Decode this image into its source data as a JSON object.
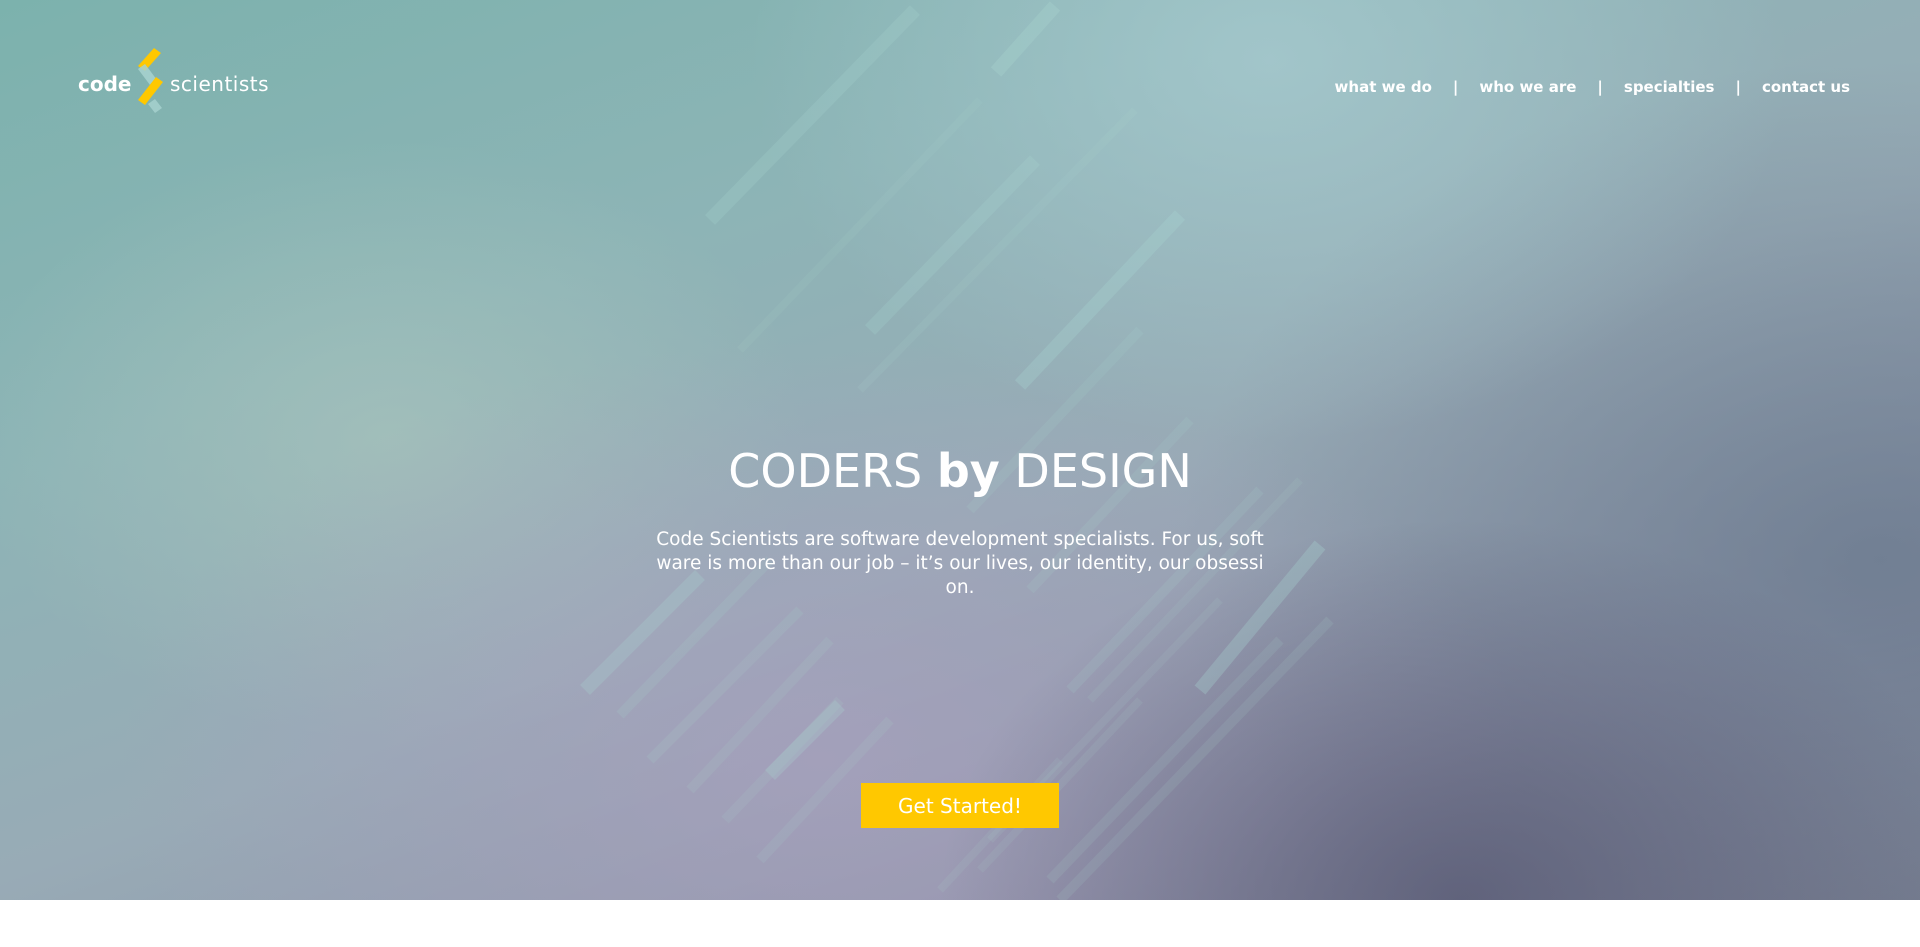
{
  "logo": {
    "text_code": "code",
    "text_scientists": "scientists",
    "mark_icon": "double-chevron-logo-icon",
    "accent_color": "#ffc800"
  },
  "nav": {
    "items": [
      {
        "label": "what we do"
      },
      {
        "label": "who we are"
      },
      {
        "label": "specialties"
      },
      {
        "label": "contact us"
      }
    ],
    "separator": "|"
  },
  "hero": {
    "headline_pre": "CODERS ",
    "headline_bold": "by",
    "headline_post": " DESIGN",
    "subtitle": "Code Scientists are software development specialists. For us, software is more than our job – it’s our lives, our identity, our obsession.",
    "cta_label": "Get Started!",
    "cta_color": "#ffc800"
  }
}
